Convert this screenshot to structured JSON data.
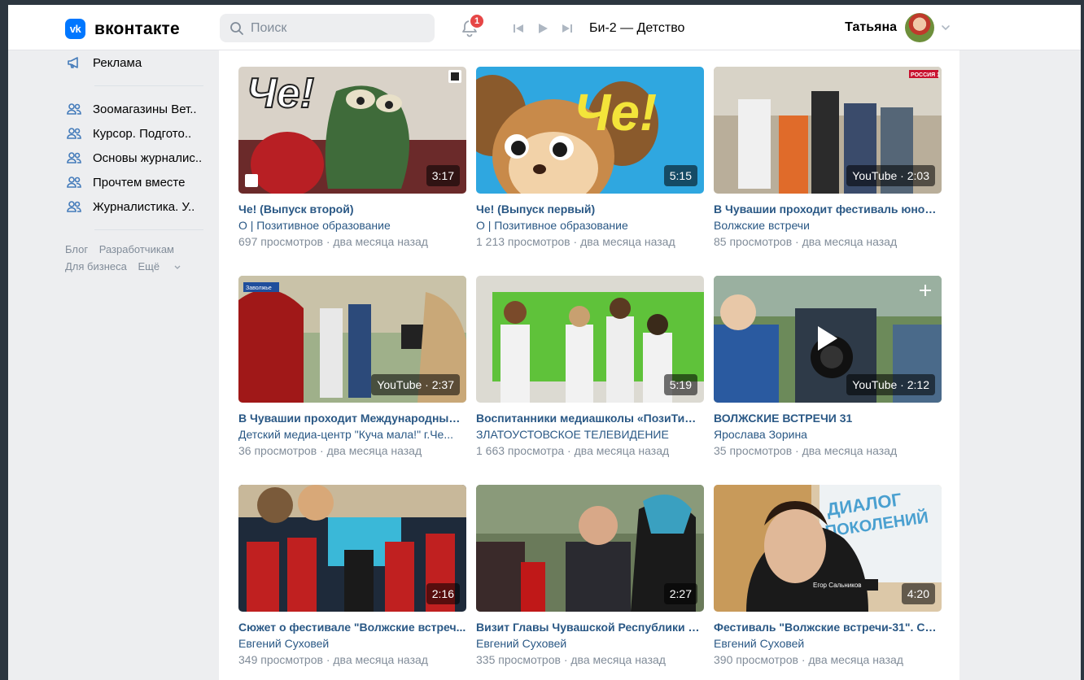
{
  "brand": {
    "logo_letters": "vk",
    "name": "вконтакте",
    "accent": "#0077ff"
  },
  "search": {
    "placeholder": "Поиск"
  },
  "notifications": {
    "count": "1"
  },
  "player": {
    "track": "Би-2 — Детство"
  },
  "user": {
    "name": "Татьяна"
  },
  "sidebar": {
    "items": [
      {
        "icon": "megaphone-icon",
        "label": "Реклама"
      },
      {
        "icon": "group-icon",
        "label": "Зоомагазины Вет.."
      },
      {
        "icon": "group-icon",
        "label": "Курсор. Подгото.."
      },
      {
        "icon": "group-icon",
        "label": "Основы журналис.."
      },
      {
        "icon": "group-icon",
        "label": "Прочтем вместе"
      },
      {
        "icon": "group-icon",
        "label": "Журналистика. У.."
      }
    ],
    "footer": {
      "blog": "Блог",
      "developers": "Разработчикам",
      "business": "Для бизнеса",
      "more": "Ещё"
    }
  },
  "videos": [
    {
      "title": "Че! (Выпуск второй)",
      "author": "О | Позитивное образование",
      "views": "697 просмотров",
      "age": "два месяца назад",
      "duration": "3:17"
    },
    {
      "title": "Че! (Выпуск первый)",
      "author": "О | Позитивное образование",
      "views": "1 213 просмотров",
      "age": "два месяца назад",
      "duration": "5:15"
    },
    {
      "title": "В Чувашии проходит фестиваль юноше...",
      "author": "Волжские встречи",
      "views": "85 просмотров",
      "age": "два месяца назад",
      "duration": "YouTube · 2:03"
    },
    {
      "title": "В Чувашии проходит Международный ...",
      "author": "Детский медиа-центр \"Куча мала!\" г.Че...",
      "views": "36 просмотров",
      "age": "два месяца назад",
      "duration": "YouTube · 2:37"
    },
    {
      "title": "Воспитанники медиашколы «ПозиТиВ»...",
      "author": "ЗЛАТОУСТОВСКОЕ ТЕЛЕВИДЕНИЕ",
      "views": "1 663 просмотра",
      "age": "два месяца назад",
      "duration": "5:19"
    },
    {
      "title": "ВОЛЖСКИЕ ВСТРЕЧИ 31",
      "author": "Ярослава Зорина",
      "views": "35 просмотров",
      "age": "два месяца назад",
      "duration": "YouTube · 2:12"
    },
    {
      "title": "Сюжет о фестивале \"Волжские встреч...",
      "author": "Евгений Суховей",
      "views": "349 просмотров",
      "age": "два месяца назад",
      "duration": "2:16"
    },
    {
      "title": "Визит Главы Чувашской Республики на...",
      "author": "Евгений Суховей",
      "views": "335 просмотров",
      "age": "два месяца назад",
      "duration": "2:27"
    },
    {
      "title": "Фестиваль \"Волжские встречи-31\". Сю...",
      "author": "Евгений Суховей",
      "views": "390 просмотров",
      "age": "два месяца назад",
      "duration": "4:20"
    }
  ],
  "thumb_text": {
    "che1": "Че!",
    "che2": "Че!",
    "dialog_line1": "ДИАЛОГ",
    "dialog_line2": "ПОКОЛЕНИЙ",
    "name_plate": "Егор Сальников",
    "zavolzhye": "Заволжье",
    "russia1": "РОССИЯ 1"
  }
}
